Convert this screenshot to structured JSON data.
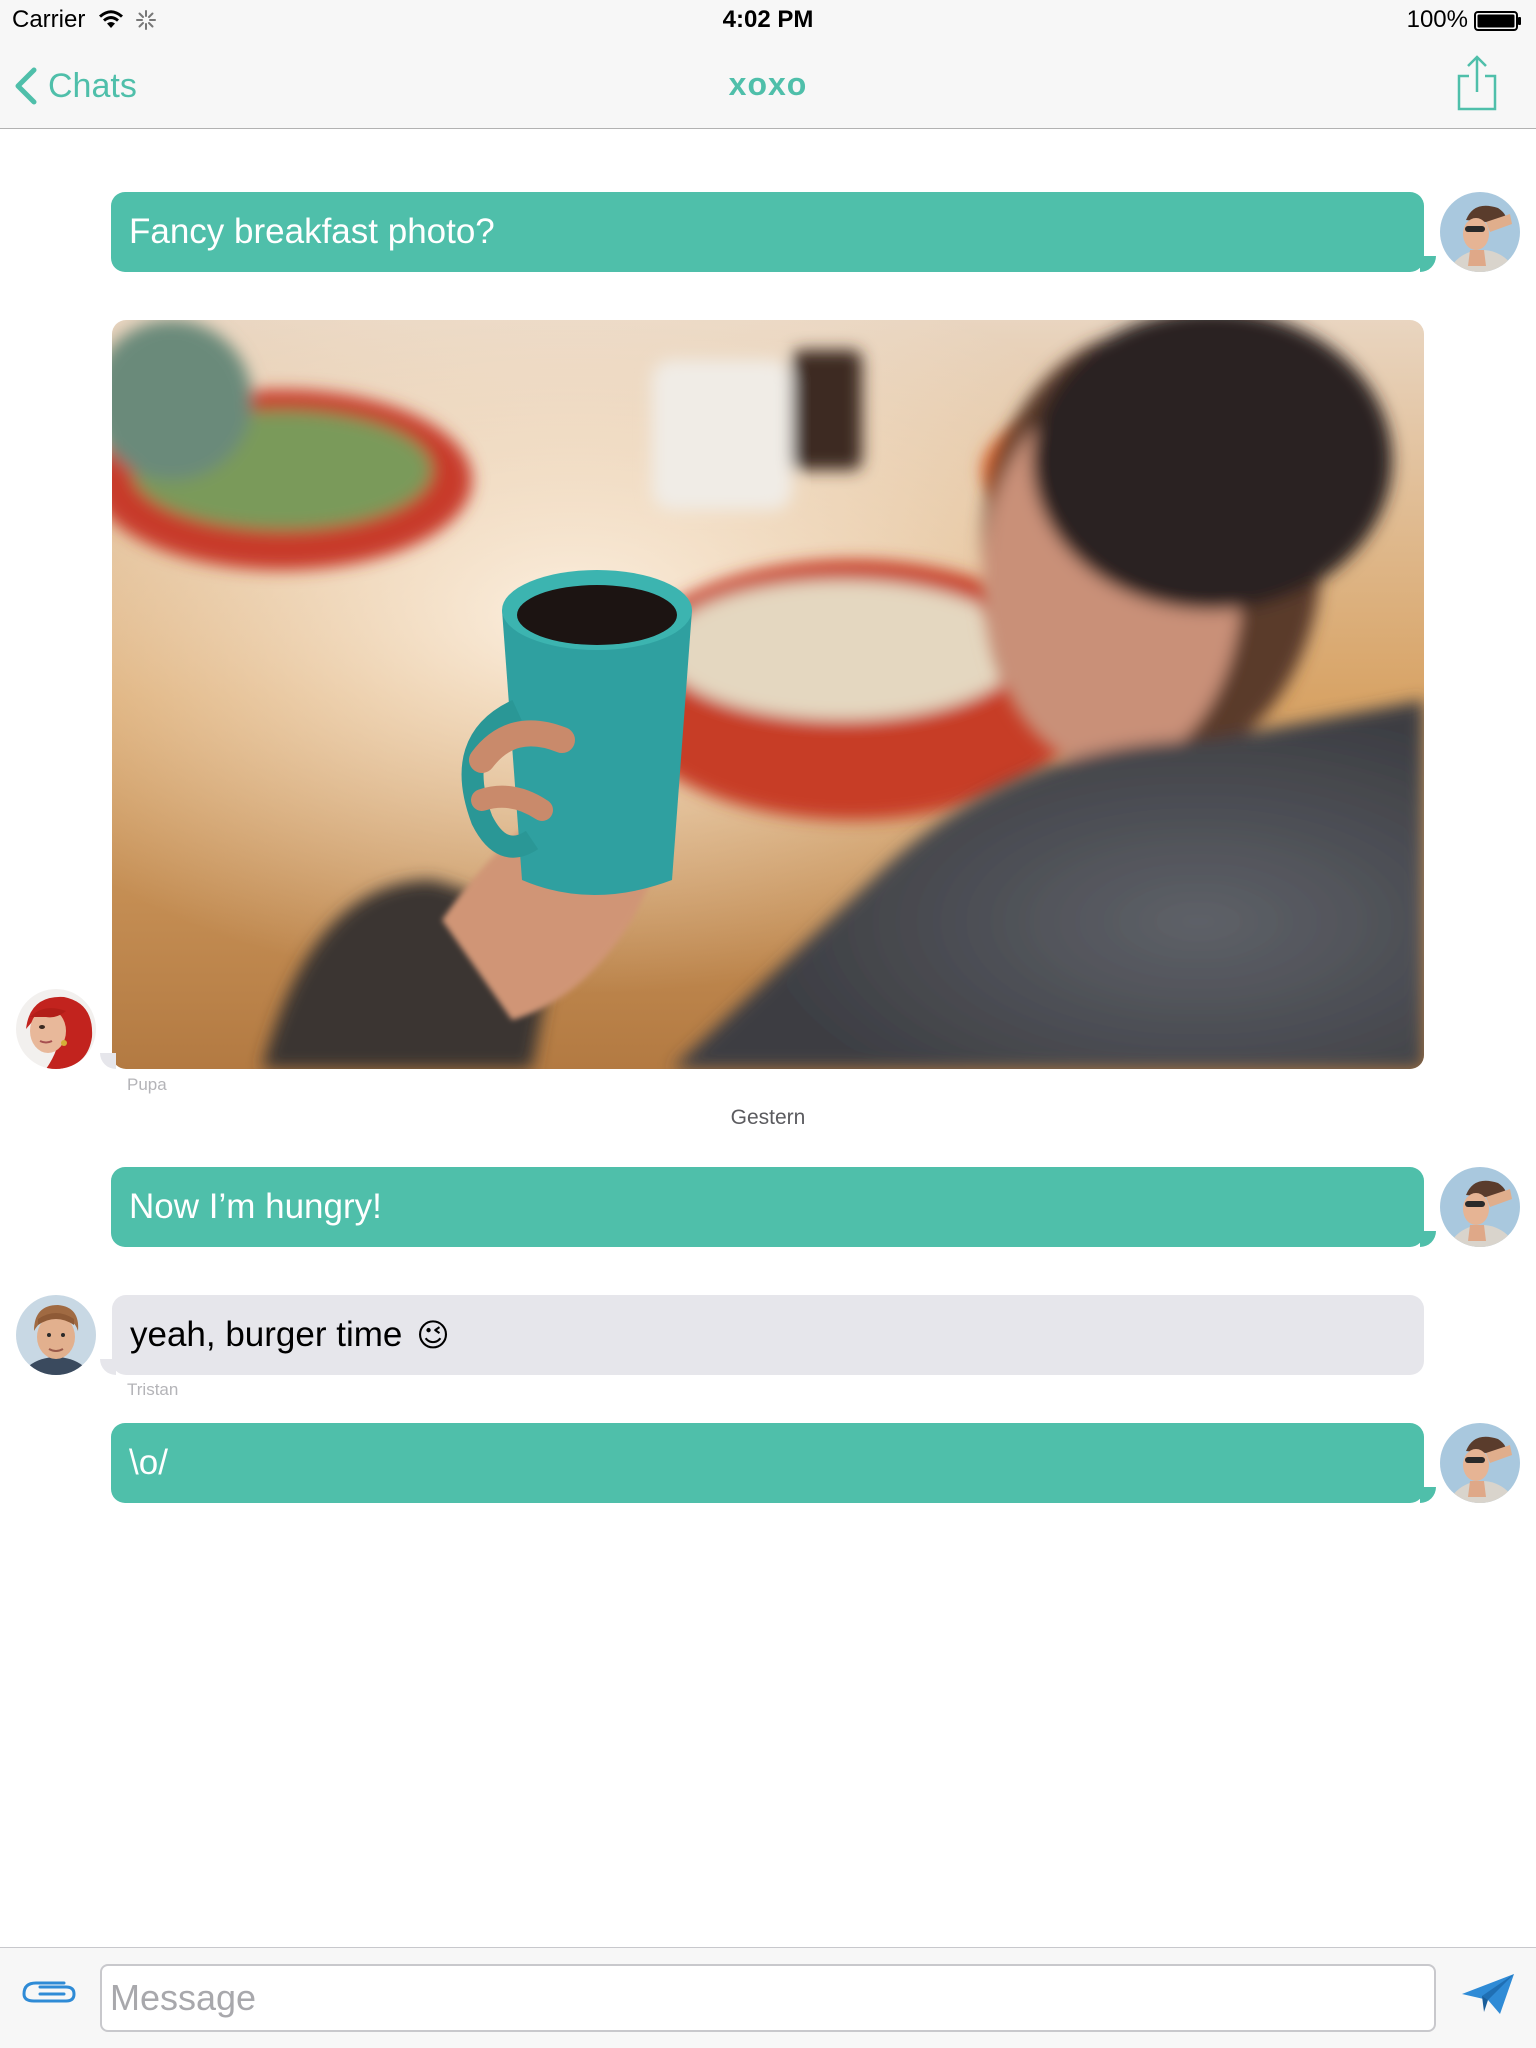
{
  "status_bar": {
    "carrier": "Carrier",
    "time": "4:02 PM",
    "battery": "100%"
  },
  "nav": {
    "back_label": "Chats",
    "title": "xoxo"
  },
  "colors": {
    "accent": "#4fbfaa",
    "incoming_bubble": "#e6e6eb"
  },
  "messages": [
    {
      "direction": "outgoing",
      "text": "Fancy breakfast photo?"
    },
    {
      "direction": "incoming",
      "type": "photo",
      "description_icon": "coffee-mug-photo",
      "sender": "Pupa"
    },
    {
      "type": "date",
      "text": "Gestern"
    },
    {
      "direction": "outgoing",
      "text": "Now I’m hungry!"
    },
    {
      "direction": "incoming",
      "text": "yeah, burger time",
      "emoji": "😉",
      "sender": "Tristan"
    },
    {
      "direction": "outgoing",
      "text": "\\o/"
    }
  ],
  "input": {
    "placeholder": "Message"
  }
}
